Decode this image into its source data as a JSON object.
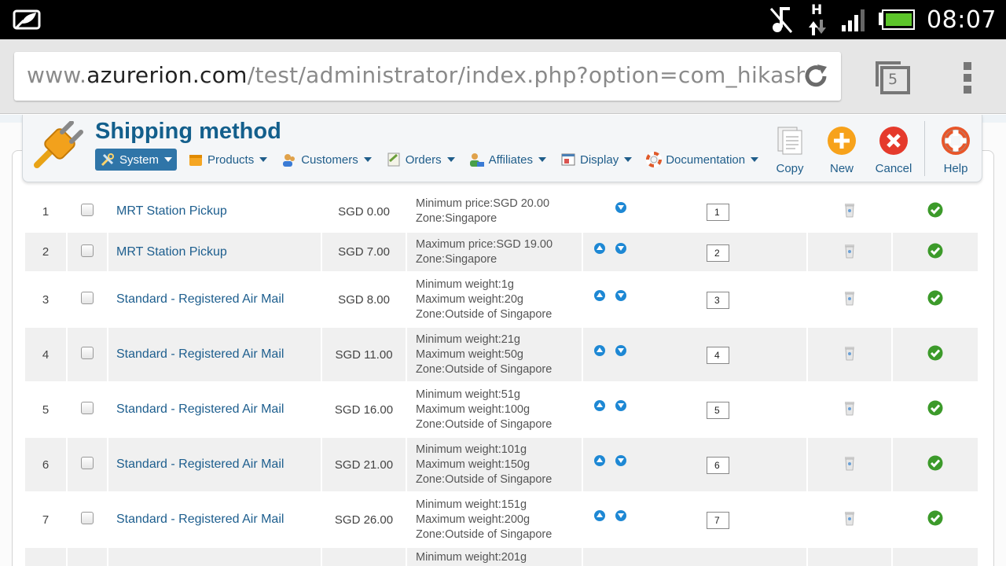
{
  "status_bar": {
    "time": "08:07",
    "network": "H"
  },
  "browser": {
    "url_prefix": "www.",
    "url_domain": "azurerion.com",
    "url_path": "/test/administrator/index.php?option=com_hikasho",
    "tab_count": "5"
  },
  "header": {
    "title": "Shipping method",
    "menu": [
      {
        "label": "System",
        "icon": "tools-icon"
      },
      {
        "label": "Products",
        "icon": "products-icon"
      },
      {
        "label": "Customers",
        "icon": "customers-icon"
      },
      {
        "label": "Orders",
        "icon": "orders-icon"
      },
      {
        "label": "Affiliates",
        "icon": "affiliates-icon"
      },
      {
        "label": "Display",
        "icon": "display-icon"
      },
      {
        "label": "Documentation",
        "icon": "lifebuoy-icon"
      }
    ],
    "toolbar": {
      "copy": "Copy",
      "new": "New",
      "cancel": "Cancel",
      "help": "Help"
    }
  },
  "rows": [
    {
      "num": "1",
      "name": "MRT Station Pickup",
      "price": "SGD 0.00",
      "restrictions": [
        "Minimum price:SGD 20.00",
        "Zone:Singapore"
      ],
      "ordering": "1"
    },
    {
      "num": "2",
      "name": "MRT Station Pickup",
      "price": "SGD 7.00",
      "restrictions": [
        "Maximum price:SGD 19.00",
        "Zone:Singapore"
      ],
      "ordering": "2"
    },
    {
      "num": "3",
      "name": "Standard - Registered Air Mail",
      "price": "SGD 8.00",
      "restrictions": [
        "Minimum weight:1g",
        "Maximum weight:20g",
        "Zone:Outside of Singapore"
      ],
      "ordering": "3"
    },
    {
      "num": "4",
      "name": "Standard - Registered Air Mail",
      "price": "SGD 11.00",
      "restrictions": [
        "Minimum weight:21g",
        "Maximum weight:50g",
        "Zone:Outside of Singapore"
      ],
      "ordering": "4"
    },
    {
      "num": "5",
      "name": "Standard - Registered Air Mail",
      "price": "SGD 16.00",
      "restrictions": [
        "Minimum weight:51g",
        "Maximum weight:100g",
        "Zone:Outside of Singapore"
      ],
      "ordering": "5"
    },
    {
      "num": "6",
      "name": "Standard - Registered Air Mail",
      "price": "SGD 21.00",
      "restrictions": [
        "Minimum weight:101g",
        "Maximum weight:150g",
        "Zone:Outside of Singapore"
      ],
      "ordering": "6"
    },
    {
      "num": "7",
      "name": "Standard - Registered Air Mail",
      "price": "SGD 26.00",
      "restrictions": [
        "Minimum weight:151g",
        "Maximum weight:200g",
        "Zone:Outside of Singapore"
      ],
      "ordering": "7"
    },
    {
      "num": "",
      "name": "",
      "price": "",
      "restrictions": [
        "Minimum weight:201g"
      ],
      "ordering": ""
    }
  ],
  "colors": {
    "title": "#135f8c",
    "link": "#1d5e8e",
    "menu_active_bg": "#2f75a8",
    "published": "#3c9a2a",
    "arrow": "#1e88d4"
  }
}
